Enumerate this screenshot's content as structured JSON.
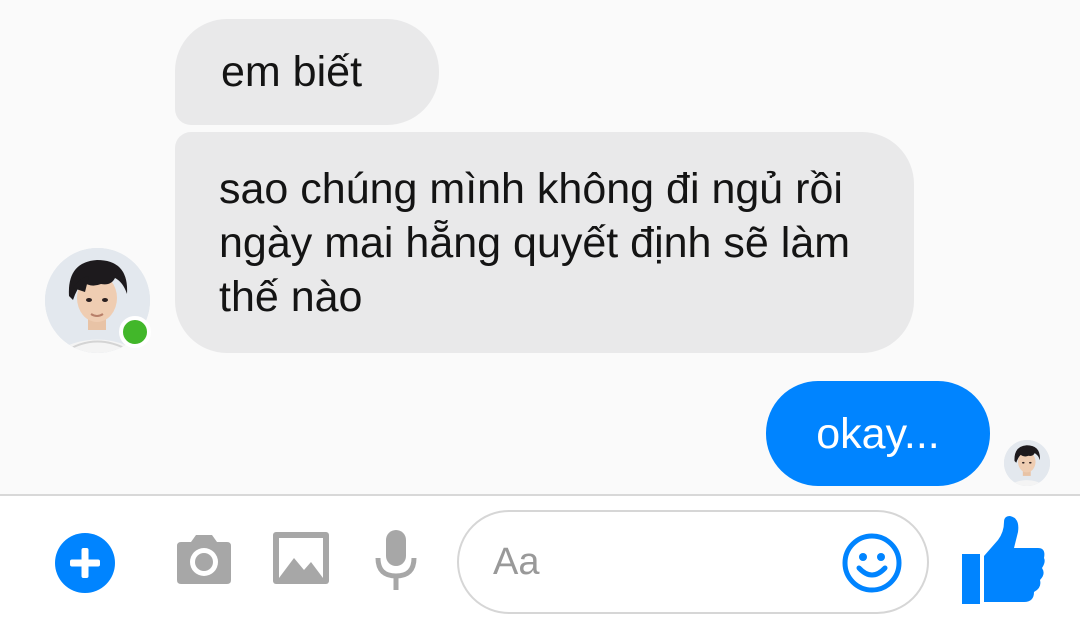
{
  "messages": [
    {
      "sender": "contact",
      "text": "em biết"
    },
    {
      "sender": "contact",
      "text": "sao chúng mình không đi ngủ rồi ngày mai hẵng quyết định sẽ làm thế nào"
    },
    {
      "sender": "me",
      "text": "okay..."
    }
  ],
  "contact": {
    "online": true,
    "online_color": "#42b72a"
  },
  "composer": {
    "input_value": "",
    "input_placeholder": "Aa",
    "icons": [
      "plus-icon",
      "camera-icon",
      "gallery-icon",
      "microphone-icon",
      "emoji-icon",
      "thumbs-up-icon"
    ]
  },
  "colors": {
    "accent": "#0084ff",
    "incoming_bubble": "#e9e9ea",
    "icon_gray": "#a7a7a7",
    "background": "#fafafa"
  }
}
